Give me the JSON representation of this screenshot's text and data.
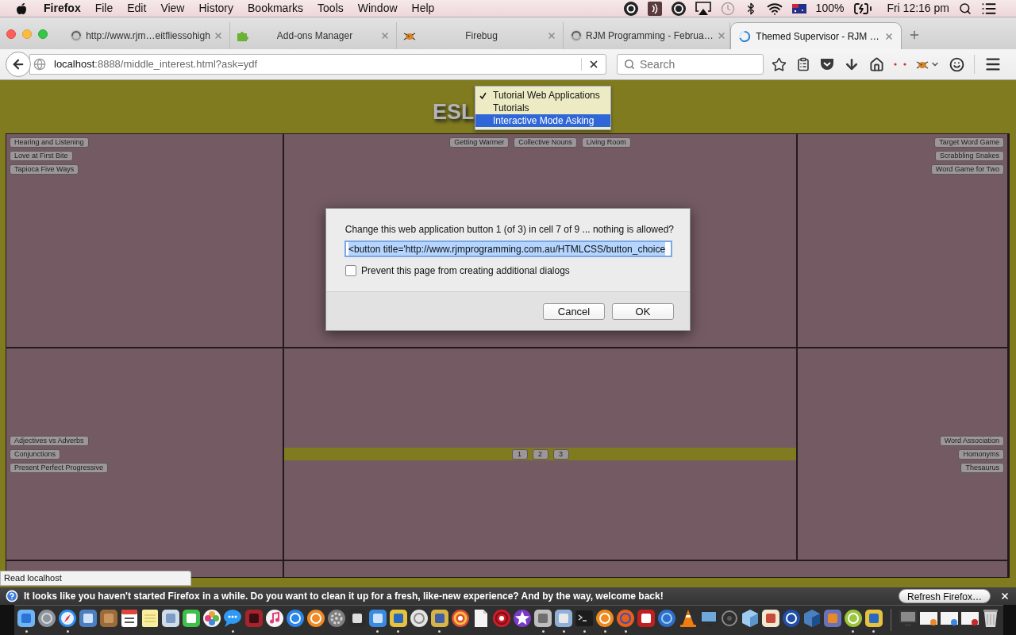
{
  "menu_bar": {
    "app_name": "Firefox",
    "menus": [
      "File",
      "Edit",
      "View",
      "History",
      "Bookmarks",
      "Tools",
      "Window",
      "Help"
    ],
    "battery": "100%",
    "clock": "Fri 12:16 pm"
  },
  "tabs": [
    {
      "title": "http://www.rjm…eitfliessohigh",
      "selected": false,
      "loading": false
    },
    {
      "title": "Add-ons Manager",
      "selected": false,
      "loading": false
    },
    {
      "title": "Firebug",
      "selected": false,
      "loading": false
    },
    {
      "title": "RJM Programming - Februa…",
      "selected": false,
      "loading": false
    },
    {
      "title": "Themed Supervisor - RJM …",
      "selected": true,
      "loading": true
    }
  ],
  "address_bar": {
    "host": "localhost",
    "path": ":8888/middle_interest.html?ask=ydf"
  },
  "search": {
    "placeholder": "Search"
  },
  "page": {
    "heading": "ESL",
    "dropdown": [
      {
        "label": "Tutorial Web Applications",
        "checked": true,
        "selected": false
      },
      {
        "label": "Tutorials",
        "checked": false,
        "selected": false
      },
      {
        "label": "Interactive Mode Asking",
        "checked": false,
        "selected": true
      }
    ],
    "cells": [
      {
        "buttons": [
          "Hearing and Listening",
          "Love at First Bite",
          "Tapioca Five Ways"
        ]
      },
      {
        "buttons": [
          "Getting Warmer",
          "Collective Nouns",
          "Living Room"
        ]
      },
      {
        "buttons": [
          "Target Word Game",
          "Scrabbling Snakes",
          "Word Game for Two"
        ]
      },
      {
        "buttons": [
          "Adjectives vs Adverbs",
          "Conjunctions",
          "Present Perfect Progressive"
        ]
      },
      {
        "pages": [
          "1",
          "2",
          "3"
        ]
      },
      {
        "buttons": [
          "Word Association",
          "Homonyms",
          "Thesaurus"
        ]
      }
    ]
  },
  "dialog": {
    "message": "Change this web application button 1 (of 3) in cell 7 of 9 ... nothing is allowed?",
    "field": {
      "value": "<button title='http://www.rjmprogramming.com.au/HTMLCSS/button_choice",
      "highlighted": true
    },
    "checkbox": {
      "label": "Prevent this page from creating additional dialogs",
      "checked": false
    },
    "buttons": [
      "Cancel",
      "OK"
    ]
  },
  "status_tooltip": "Read localhost",
  "notification": {
    "message": "It looks like you haven't started Firefox in a while. Do you want to clean it up for a fresh, like-new experience? And by the way, welcome back!",
    "button": "Refresh Firefox…"
  },
  "dock": {
    "items": [
      {
        "running": true
      },
      {
        "running": false
      },
      {
        "running": true
      },
      {
        "running": false
      },
      {
        "running": false
      },
      {
        "running": false
      },
      {
        "running": false
      },
      {
        "running": false
      },
      {
        "running": false
      },
      {
        "running": false
      },
      {
        "running": true
      },
      {
        "running": false
      },
      {
        "running": false
      },
      {
        "running": false
      },
      {
        "running": false
      },
      {
        "running": false
      },
      {
        "running": false
      },
      {
        "running": true
      },
      {
        "running": true
      },
      {
        "running": false
      },
      {
        "running": true
      },
      {
        "running": false
      },
      {
        "running": false
      },
      {
        "running": false
      },
      {
        "running": false
      },
      {
        "running": true
      },
      {
        "running": true
      },
      {
        "running": true
      },
      {
        "running": true
      },
      {
        "running": true
      },
      {
        "running": false
      },
      {
        "running": false
      },
      {
        "running": false
      },
      {
        "running": false
      },
      {
        "running": false
      },
      {
        "running": false
      },
      {
        "running": false
      },
      {
        "running": false
      },
      {
        "running": false
      },
      {
        "running": false
      },
      {
        "running": true
      },
      {
        "running": true
      },
      {
        "running": false
      },
      {
        "running": false
      },
      {
        "running": false
      },
      {
        "running": false
      },
      {
        "running": false
      }
    ]
  }
}
